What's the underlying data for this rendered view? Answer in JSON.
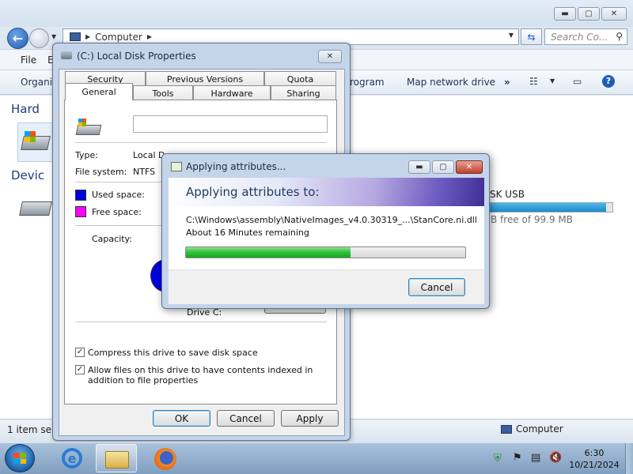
{
  "explorer": {
    "breadcrumb": "Computer",
    "search_placeholder": "Search Co...",
    "menu": [
      "File",
      "E"
    ],
    "toolbar": {
      "organize": "Organiz",
      "program": "rogram",
      "map_network_drive": "Map network drive",
      "more": "»"
    },
    "sections": {
      "hard_disks": "Hard",
      "devices": "Devic"
    },
    "usb_drive": {
      "label": "SK USB",
      "free_text": "B free of 99.9 MB",
      "used_fraction": 0.95
    },
    "status": {
      "items": "1 item sele",
      "location": "Computer"
    }
  },
  "properties": {
    "title": "(C:) Local Disk Properties",
    "tabs_row1": [
      "Security",
      "Previous Versions",
      "Quota"
    ],
    "tabs_row2": [
      "General",
      "Tools",
      "Hardware",
      "Sharing"
    ],
    "name_value": "",
    "type_label": "Type:",
    "type_value": "Local D",
    "fs_label": "File system:",
    "fs_value": "NTFS",
    "used_label": "Used space:",
    "free_label": "Free space:",
    "capacity_label": "Capacity:",
    "drive_label": "Drive C:",
    "compress_label": "Compress this drive to save disk space",
    "compress_checked": true,
    "index_label": "Allow files on this drive to have contents indexed in addition to file properties",
    "index_checked": true,
    "ok": "OK",
    "cancel": "Cancel",
    "apply": "Apply",
    "used_color": "#0000e0",
    "free_color": "#ff00ff"
  },
  "applying": {
    "title": "Applying attributes...",
    "heading": "Applying attributes to:",
    "path": "C:\\Windows\\assembly\\NativeImages_v4.0.30319_...\\StanCore.ni.dll",
    "remaining": "About 16 Minutes remaining",
    "progress": 0.59,
    "cancel": "Cancel"
  },
  "taskbar": {
    "time": "6:30",
    "date": "10/21/2024"
  }
}
